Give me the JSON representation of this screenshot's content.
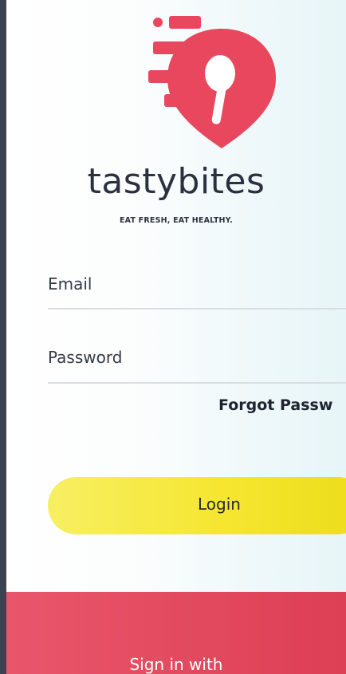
{
  "brand": {
    "name": "tastybites",
    "tagline": "EAT FRESH, EAT HEALTHY."
  },
  "form": {
    "email_label": "Email",
    "password_label": "Password",
    "forgot_label": "Forgot Passw",
    "login_label": "Login"
  },
  "footer": {
    "signin_label": "Sign in with"
  },
  "colors": {
    "logo_red": "#e8475d",
    "button_yellow": "#f6e630",
    "panel_red": "#e14a5f",
    "text_dark": "#2b3140"
  }
}
